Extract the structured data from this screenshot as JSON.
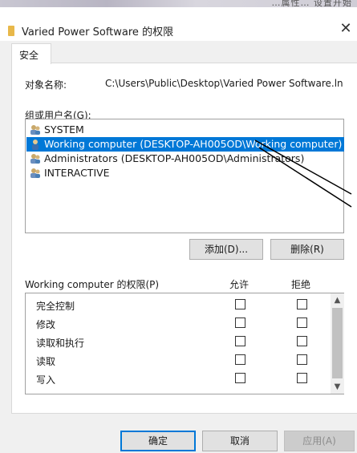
{
  "background": {
    "top_strip_text": "…属性…  设置开始"
  },
  "window": {
    "title": "Varied Power Software 的权限",
    "close_glyph": "✕"
  },
  "tabs": [
    {
      "label": "安全"
    }
  ],
  "object": {
    "label": "对象名称:",
    "path": "C:\\Users\\Public\\Desktop\\Varied Power Software.lnk"
  },
  "groups": {
    "label": "组或用户名(G):",
    "items": [
      {
        "name": "SYSTEM",
        "icon": "group-icon",
        "selected": false
      },
      {
        "name": "Working computer (DESKTOP-AH005OD\\Working computer)",
        "icon": "user-icon",
        "selected": true
      },
      {
        "name": "Administrators (DESKTOP-AH005OD\\Administrators)",
        "icon": "group-icon",
        "selected": false
      },
      {
        "name": "INTERACTIVE",
        "icon": "group-icon",
        "selected": false
      }
    ],
    "add_button": "添加(D)...",
    "remove_button": "删除(R)"
  },
  "permissions": {
    "label": "Working computer 的权限(P)",
    "allow_header": "允许",
    "deny_header": "拒绝",
    "rows": [
      {
        "name": "完全控制",
        "allow": false,
        "deny": false
      },
      {
        "name": "修改",
        "allow": false,
        "deny": false
      },
      {
        "name": "读取和执行",
        "allow": false,
        "deny": false
      },
      {
        "name": "读取",
        "allow": false,
        "deny": false
      },
      {
        "name": "写入",
        "allow": false,
        "deny": false
      }
    ]
  },
  "footer": {
    "ok_button": "确定",
    "cancel_button": "取消",
    "apply_button": "应用(A)"
  },
  "colors": {
    "selection": "#0078d7",
    "button_face": "#e1e1e1",
    "dialog_background": "#f0f0f0"
  }
}
